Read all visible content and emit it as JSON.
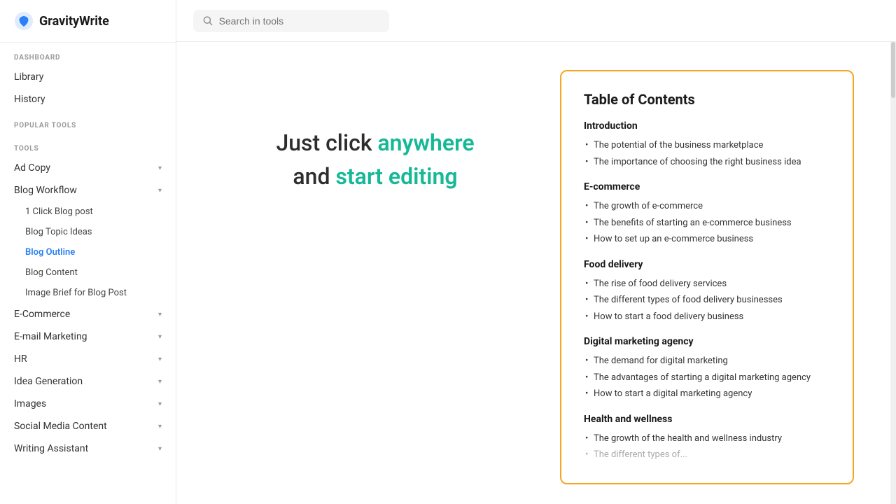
{
  "logo": {
    "text": "GravityWrite"
  },
  "sidebar": {
    "dashboard_label": "DASHBOARD",
    "popular_tools_label": "POPULAR TOOLS",
    "tools_label": "TOOLS",
    "library": "Library",
    "history": "History",
    "ad_copy": "Ad Copy",
    "blog_workflow": "Blog Workflow",
    "sub_items": [
      {
        "label": "1 Click Blog post",
        "active": false
      },
      {
        "label": "Blog Topic Ideas",
        "active": false
      },
      {
        "label": "Blog Outline",
        "active": true
      },
      {
        "label": "Blog Content",
        "active": false
      },
      {
        "label": "Image Brief for Blog Post",
        "active": false
      }
    ],
    "categories": [
      {
        "label": "E-Commerce"
      },
      {
        "label": "E-mail Marketing"
      },
      {
        "label": "HR"
      },
      {
        "label": "Idea Generation"
      },
      {
        "label": "Images"
      },
      {
        "label": "Social Media Content"
      },
      {
        "label": "Writing Assistant"
      }
    ]
  },
  "header": {
    "search_placeholder": "Search in tools"
  },
  "main": {
    "prompt_prefix": "Just click ",
    "prompt_highlight1": "anywhere",
    "prompt_middle": " and ",
    "prompt_highlight2": "start editing"
  },
  "toc": {
    "title": "Table of Contents",
    "sections": [
      {
        "heading": "Introduction",
        "bullets": [
          "The potential of the business marketplace",
          "The importance of choosing the right business idea"
        ]
      },
      {
        "heading": "E-commerce",
        "bullets": [
          "The growth of e-commerce",
          "The benefits of starting an e-commerce business",
          "How to set up an e-commerce business"
        ]
      },
      {
        "heading": "Food delivery",
        "bullets": [
          "The rise of food delivery services",
          "The different types of food delivery businesses",
          "How to start a food delivery business"
        ]
      },
      {
        "heading": "Digital marketing agency",
        "bullets": [
          "The demand for digital marketing",
          "The advantages of starting a digital marketing agency",
          "How to start a digital marketing agency"
        ]
      },
      {
        "heading": "Health and wellness",
        "bullets": [
          "The growth of the health and wellness industry",
          "The different types of..."
        ]
      }
    ]
  }
}
